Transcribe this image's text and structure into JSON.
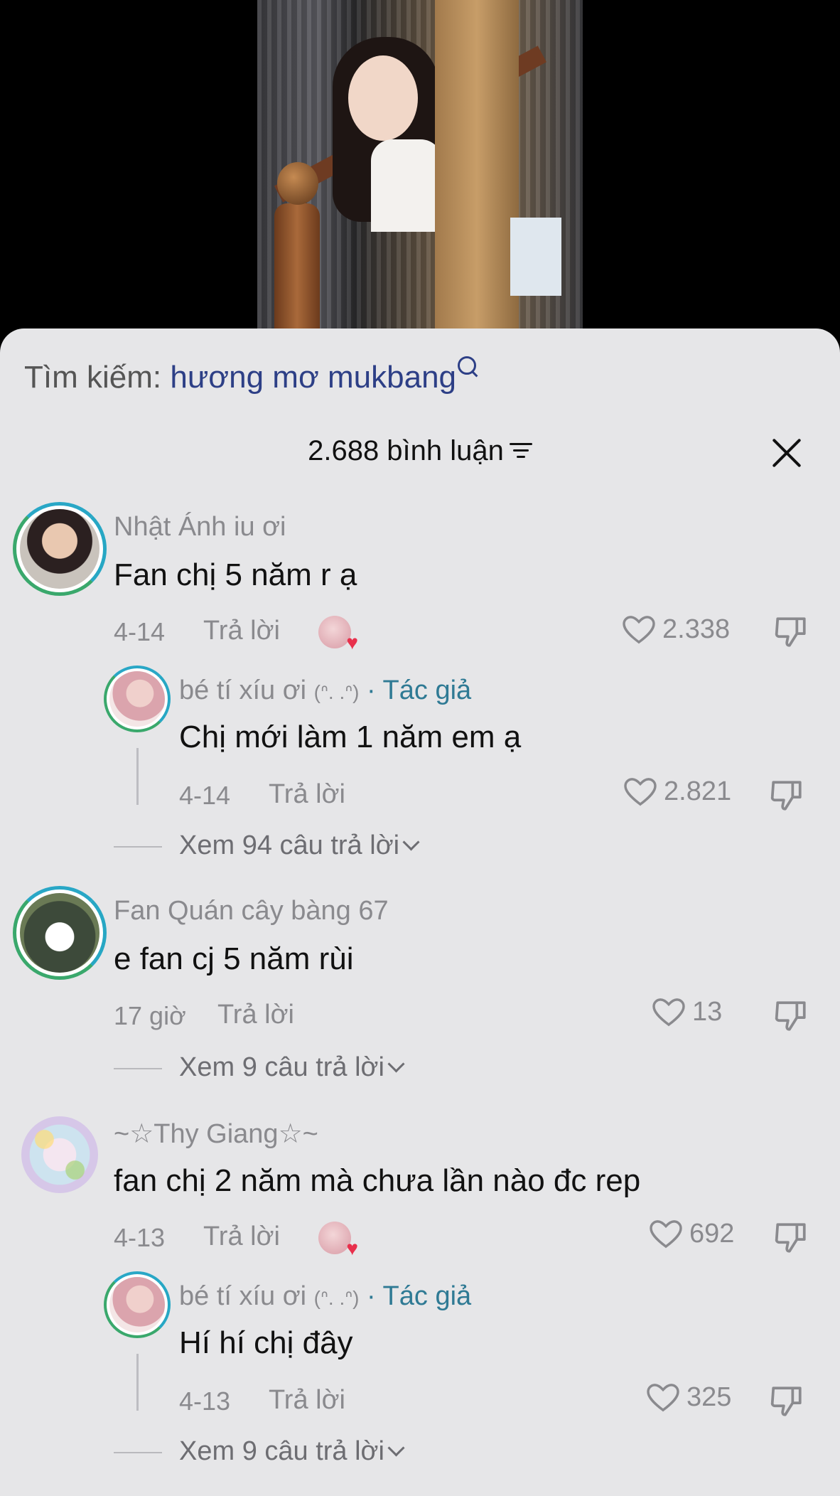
{
  "search": {
    "label": "Tìm kiếm:",
    "query": "hương mơ mukbang"
  },
  "header": {
    "count_label": "2.688 bình luận"
  },
  "comments": [
    {
      "user": "Nhật Ánh iu ơi",
      "text": "Fan chị 5 năm r ạ",
      "date": "4-14",
      "reply_label": "Trả lời",
      "likes": "2.338",
      "author_reply": {
        "user": "bé tí xíu ơi",
        "kaomoji": "(ᐢ. .ᐢ)",
        "author_tag": "· Tác giả",
        "text": "Chị mới làm 1 năm em ạ",
        "date": "4-14",
        "reply_label": "Trả lời",
        "likes": "2.821"
      },
      "view_replies": "Xem 94 câu trả lời"
    },
    {
      "user": "Fan Quán cây bàng 67",
      "text": "e fan cj 5 năm rùi",
      "date": "17 giờ",
      "reply_label": "Trả lời",
      "likes": "13",
      "view_replies": "Xem 9 câu trả lời"
    },
    {
      "user": "~☆Thy Giang☆~",
      "text": "fan chị 2 năm mà chưa lần nào đc rep",
      "date": "4-13",
      "reply_label": "Trả lời",
      "likes": "692",
      "author_reply": {
        "user": "bé tí xíu ơi",
        "kaomoji": "(ᐢ. .ᐢ)",
        "author_tag": "· Tác giả",
        "text": "Hí hí chị đây",
        "date": "4-13",
        "reply_label": "Trả lời",
        "likes": "325"
      },
      "view_replies": "Xem 9 câu trả lời"
    }
  ],
  "colors": {
    "sheet_bg": "#e6e6e8",
    "query": "#2d3f86",
    "author_tag": "#2f7a94",
    "like_heart": "#e8304c"
  },
  "icons": [
    "search-icon",
    "filter-icon",
    "close-icon",
    "heart-icon",
    "dislike-icon",
    "chevron-down-icon"
  ]
}
